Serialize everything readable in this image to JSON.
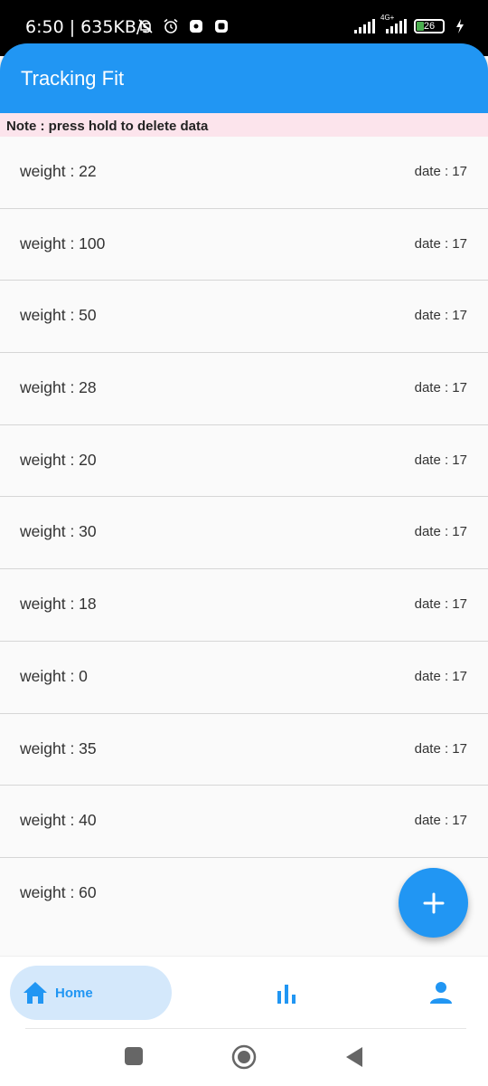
{
  "status_bar": {
    "time": "6:50 | 635KB/s",
    "network_label": "4G+",
    "battery_level": "26",
    "icons": [
      "mute-bell-icon",
      "alarm-icon",
      "app-notification-icon",
      "app-notification-icon",
      "signal-icon",
      "signal-icon",
      "battery-icon",
      "charging-icon"
    ]
  },
  "app_bar": {
    "title": "Tracking Fit"
  },
  "note": "Note : press hold to delete data",
  "entries": [
    {
      "weight": "weight : 22",
      "date": "date : 17"
    },
    {
      "weight": "weight : 100",
      "date": "date : 17"
    },
    {
      "weight": "weight : 50",
      "date": "date : 17"
    },
    {
      "weight": "weight : 28",
      "date": "date : 17"
    },
    {
      "weight": "weight : 20",
      "date": "date : 17"
    },
    {
      "weight": "weight : 30",
      "date": "date : 17"
    },
    {
      "weight": "weight : 18",
      "date": "date : 17"
    },
    {
      "weight": "weight : 0",
      "date": "date : 17"
    },
    {
      "weight": "weight : 35",
      "date": "date : 17"
    },
    {
      "weight": "weight : 40",
      "date": "date : 17"
    },
    {
      "weight": "weight : 60",
      "date": ""
    }
  ],
  "fab": {
    "icon": "plus-icon"
  },
  "bottom_nav": {
    "home_label": "Home",
    "home_icon": "home-icon",
    "stats_icon": "bar-chart-icon",
    "profile_icon": "person-icon",
    "accent": "#2196f3"
  },
  "colors": {
    "primary": "#2196f3",
    "note_bg": "#fce4ec",
    "list_bg": "#fafafa"
  }
}
